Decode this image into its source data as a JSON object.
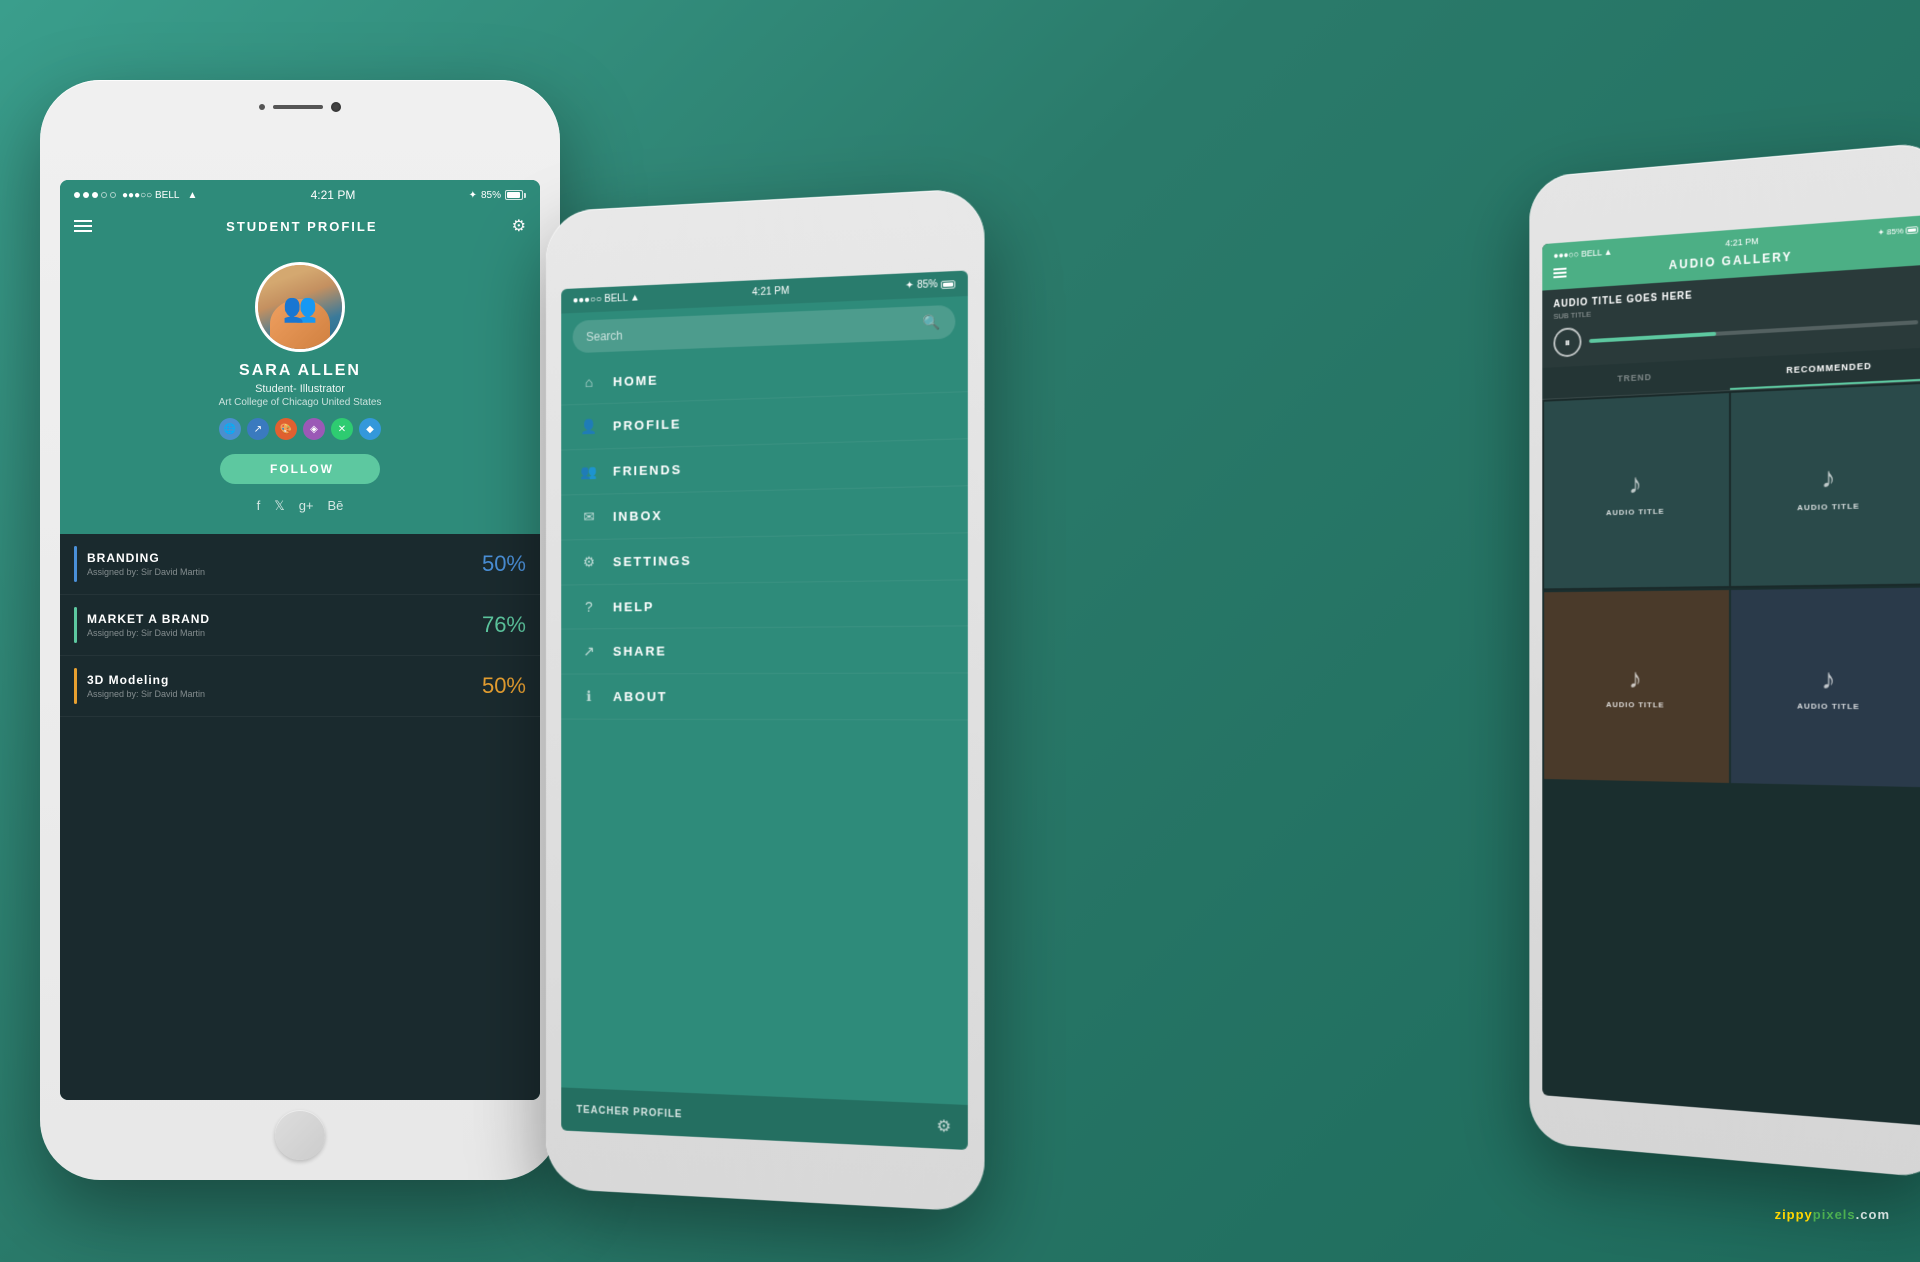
{
  "background": {
    "color": "#2e8b7a"
  },
  "phone1": {
    "status": {
      "carrier": "●●●○○ BELL",
      "wifi": "WiFi",
      "time": "4:21 PM",
      "bluetooth": "BT",
      "battery": "85%"
    },
    "title": "STUDENT PROFILE",
    "user": {
      "name": "SARA ALLEN",
      "role": "Student- Illustrator",
      "school": "Art College of Chicago United States"
    },
    "follow_btn": "FOLLOW",
    "social_icons": [
      "f",
      "𝕏",
      "g+",
      "Bē"
    ],
    "courses": [
      {
        "title": "BRANDING",
        "assigned": "Assigned by: Sir David Martin",
        "percent": "50%",
        "color": "#4a90d9"
      },
      {
        "title": "MARKET A BRAND",
        "assigned": "Assigned by: Sir David Martin",
        "percent": "76%",
        "color": "#5dc8a0"
      },
      {
        "title": "3D Modeling",
        "assigned": "Assigned by: Sir David Martin",
        "percent": "50%",
        "color": "#e8a030"
      }
    ]
  },
  "phone2": {
    "status": {
      "carrier": "●●●○○ BELL",
      "wifi": "WiFi",
      "time": "4:21 PM",
      "bluetooth": "BT",
      "battery": "85%"
    },
    "search_placeholder": "Search",
    "nav_items": [
      {
        "icon": "⌂",
        "label": "HOME"
      },
      {
        "icon": "👤",
        "label": "PROFILE"
      },
      {
        "icon": "👥",
        "label": "FRIENDS"
      },
      {
        "icon": "✉",
        "label": "INBOX"
      },
      {
        "icon": "⚙",
        "label": "SETTINGS"
      },
      {
        "icon": "?",
        "label": "HELP"
      },
      {
        "icon": "↗",
        "label": "SHARE"
      },
      {
        "icon": "ℹ",
        "label": "ABOUT"
      }
    ],
    "teacher_label": "TEACHER PROFILE"
  },
  "phone3": {
    "status": {
      "carrier": "●●●○○ BELL",
      "wifi": "WiFi",
      "time": "4:21 PM",
      "bluetooth": "BT",
      "battery": "85%"
    },
    "title": "AUDIO GALLERY",
    "now_playing": {
      "title": "AUDIO TITLE GOES HERE",
      "subtitle": "SUB TITLE"
    },
    "tabs": [
      "TREND",
      "RECOMMENDED"
    ],
    "active_tab": "RECOMMENDED",
    "audio_cards": [
      {
        "title": "AUDIO TITLE",
        "color": "#2a4a4a"
      },
      {
        "title": "AUDIO TITLE",
        "color": "#3a5a6a"
      },
      {
        "title": "AUDIO TITLE",
        "color": "#4a5a3a"
      },
      {
        "title": "AUDIO TITLE",
        "color": "#3a4a5a"
      }
    ]
  },
  "watermark": {
    "text_prefix": "zippy",
    "text_suffix": "pixels.com"
  }
}
